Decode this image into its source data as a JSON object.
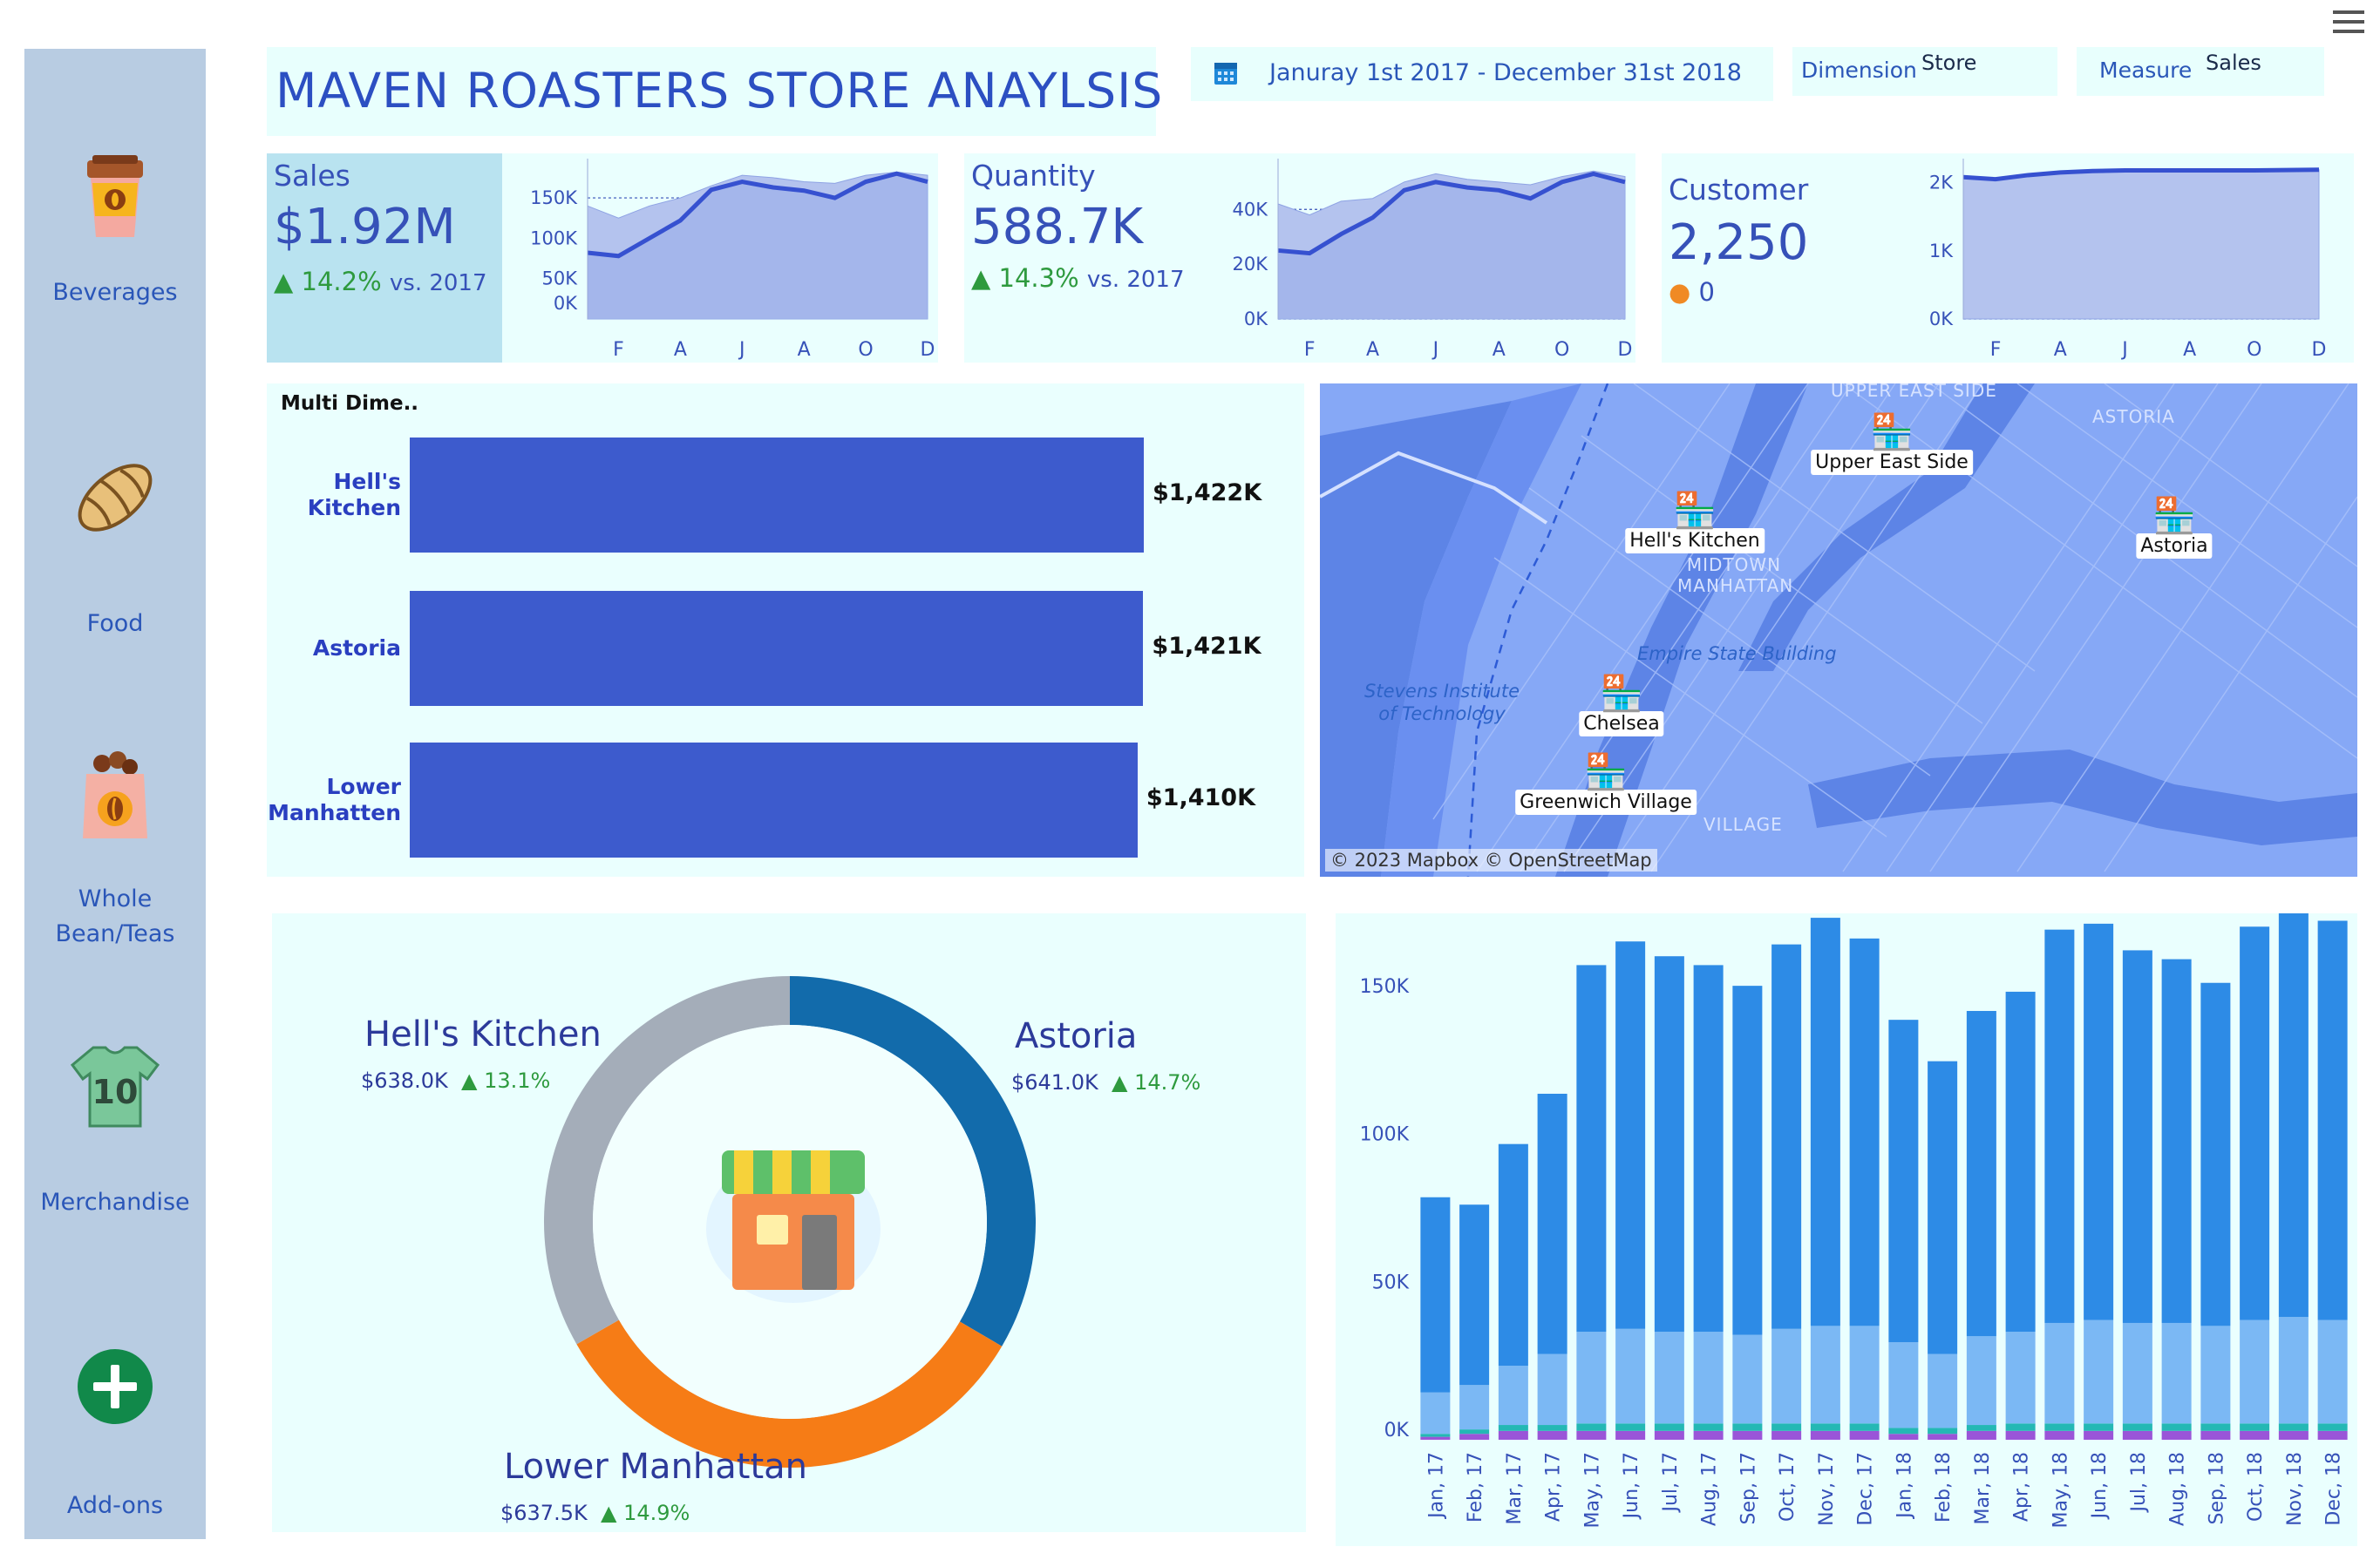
{
  "sidebar": {
    "items": [
      {
        "label": "Beverages",
        "icon": "coffee-cup-icon"
      },
      {
        "label": "Food",
        "icon": "croissant-icon"
      },
      {
        "label": "Whole\nBean/Teas",
        "icon": "coffee-bean-bag-icon"
      },
      {
        "label": "Merchandise",
        "icon": "tshirt-icon"
      },
      {
        "label": "Add-ons",
        "icon": "plus-icon"
      }
    ]
  },
  "header": {
    "title": "MAVEN ROASTERS STORE ANAYLSIS",
    "date_range": "Januray 1st 2017 - December 31st 2018",
    "dimension_label": "Dimension",
    "dimension_value": "Store",
    "measure_label": "Measure",
    "measure_value": "Sales"
  },
  "kpis": {
    "sales": {
      "title": "Sales",
      "value": "$1.92M",
      "change": "14.2%",
      "vs": "vs. 2017"
    },
    "quantity": {
      "title": "Quantity",
      "value": "588.7K",
      "change": "14.3%",
      "vs": "vs. 2017"
    },
    "customer": {
      "title": "Customer",
      "value": "2,250",
      "change": "0"
    }
  },
  "colors": {
    "accent": "#3a5bd0",
    "bar": "#3d5bcd",
    "positive": "#2e9a3e",
    "neutral": "#f08a24"
  },
  "chart_data": [
    {
      "type": "area",
      "title": "Sales",
      "x_ticks": [
        "F",
        "A",
        "J",
        "A",
        "O",
        "D"
      ],
      "y_ticks": [
        "150K",
        "100K",
        "50K",
        "0K"
      ],
      "ylim": [
        0,
        190000
      ],
      "series": [
        {
          "values": [
            82000,
            78000,
            100000,
            122000,
            160000,
            170000,
            163000,
            159000,
            150000,
            170000,
            180000,
            170000
          ]
        },
        {
          "values": [
            140000,
            125000,
            140000,
            150000,
            165000,
            178000,
            175000,
            170000,
            168000,
            178000,
            182000,
            178000
          ]
        }
      ]
    },
    {
      "type": "area",
      "title": "Quantity",
      "x_ticks": [
        "F",
        "A",
        "J",
        "A",
        "O",
        "D"
      ],
      "y_ticks": [
        "40K",
        "20K",
        "0K"
      ],
      "ylim": [
        0,
        56000
      ],
      "series": [
        {
          "values": [
            25000,
            24000,
            31000,
            37000,
            47000,
            50000,
            48000,
            47000,
            44000,
            50000,
            53000,
            50000
          ]
        },
        {
          "values": [
            42000,
            38000,
            43000,
            44000,
            50000,
            53000,
            51000,
            50000,
            49000,
            52000,
            54000,
            52000
          ]
        }
      ]
    },
    {
      "type": "area",
      "title": "Customer",
      "x_ticks": [
        "F",
        "A",
        "J",
        "A",
        "O",
        "D"
      ],
      "y_ticks": [
        "2K",
        "1K",
        "0K"
      ],
      "ylim": [
        0,
        2250
      ],
      "series": [
        {
          "values": [
            2080,
            2050,
            2110,
            2150,
            2170,
            2180,
            2180,
            2180,
            2180,
            2180,
            2185,
            2190
          ]
        }
      ]
    },
    {
      "type": "bar",
      "title": "Multi Dime..",
      "categories": [
        "Hell's\nKitchen",
        "Astoria",
        "Lower\nManhatten"
      ],
      "values": [
        1422,
        1421,
        1410
      ],
      "value_labels": [
        "$1,422K",
        "$1,421K",
        "$1,410K"
      ],
      "xlim": [
        0,
        1422
      ]
    },
    {
      "type": "pie",
      "slices": [
        {
          "name": "Astoria",
          "value": 641.0,
          "value_label": "$641.0K",
          "change": "14.7%",
          "color": "#126bab"
        },
        {
          "name": "Lower Manhattan",
          "value": 637.5,
          "value_label": "$637.5K",
          "change": "14.9%",
          "color": "#f67c16"
        },
        {
          "name": "Hell's Kitchen",
          "value": 638.0,
          "value_label": "$638.0K",
          "change": "13.1%",
          "color": "#a4adb9"
        }
      ]
    },
    {
      "type": "bar",
      "stacked": true,
      "categories": [
        "Jan, 17",
        "Feb, 17",
        "Mar, 17",
        "Apr, 17",
        "May, 17",
        "Jun, 17",
        "Jul, 17",
        "Aug, 17",
        "Sep, 17",
        "Oct, 17",
        "Nov, 17",
        "Dec, 17",
        "Jan, 18",
        "Feb, 18",
        "Mar, 18",
        "Apr, 18",
        "May, 18",
        "Jun, 18",
        "Jul, 18",
        "Aug, 18",
        "Sep, 18",
        "Oct, 18",
        "Nov, 18",
        "Dec, 18"
      ],
      "y_ticks": [
        "150K",
        "100K",
        "50K",
        "0K"
      ],
      "ylim": [
        0,
        178000
      ],
      "series": [
        {
          "color": "#9a55d8",
          "values": [
            1000,
            2000,
            3000,
            3000,
            3000,
            3000,
            3000,
            3000,
            3000,
            3000,
            3000,
            3000,
            2000,
            2000,
            3000,
            3000,
            3000,
            3000,
            3000,
            3000,
            3000,
            3000,
            3000,
            3000
          ]
        },
        {
          "color": "#24b8b4",
          "values": [
            1000,
            1500,
            2000,
            2000,
            2500,
            2500,
            2500,
            2500,
            2500,
            2500,
            2500,
            2500,
            2000,
            2000,
            2000,
            2500,
            2500,
            2500,
            2500,
            2500,
            2500,
            2500,
            2500,
            2500
          ]
        },
        {
          "color": "#7bb8f4",
          "values": [
            14000,
            15000,
            20000,
            24000,
            31000,
            32000,
            31000,
            31000,
            30000,
            32000,
            33000,
            33000,
            29000,
            25000,
            30000,
            31000,
            34000,
            35000,
            34000,
            34000,
            33000,
            35000,
            36000,
            35000
          ]
        },
        {
          "color": "#2d8be6",
          "values": [
            66000,
            61000,
            75000,
            88000,
            124000,
            131000,
            127000,
            124000,
            118000,
            130000,
            138000,
            131000,
            109000,
            99000,
            110000,
            115000,
            133000,
            134000,
            126000,
            123000,
            116000,
            133000,
            140000,
            135000
          ]
        }
      ]
    }
  ],
  "map": {
    "labels": [
      "Upper East Side",
      "Hell's Kitchen",
      "Astoria",
      "Chelsea",
      "Greenwich Village"
    ],
    "areas": [
      "UPPER EAST SIDE",
      "ASTORIA",
      "MIDTOWN MANHATTAN",
      "VILLAGE"
    ],
    "places": [
      "Empire State Building",
      "Stevens Institute of Technology"
    ],
    "attribution": "© 2023 Mapbox © OpenStreetMap"
  }
}
